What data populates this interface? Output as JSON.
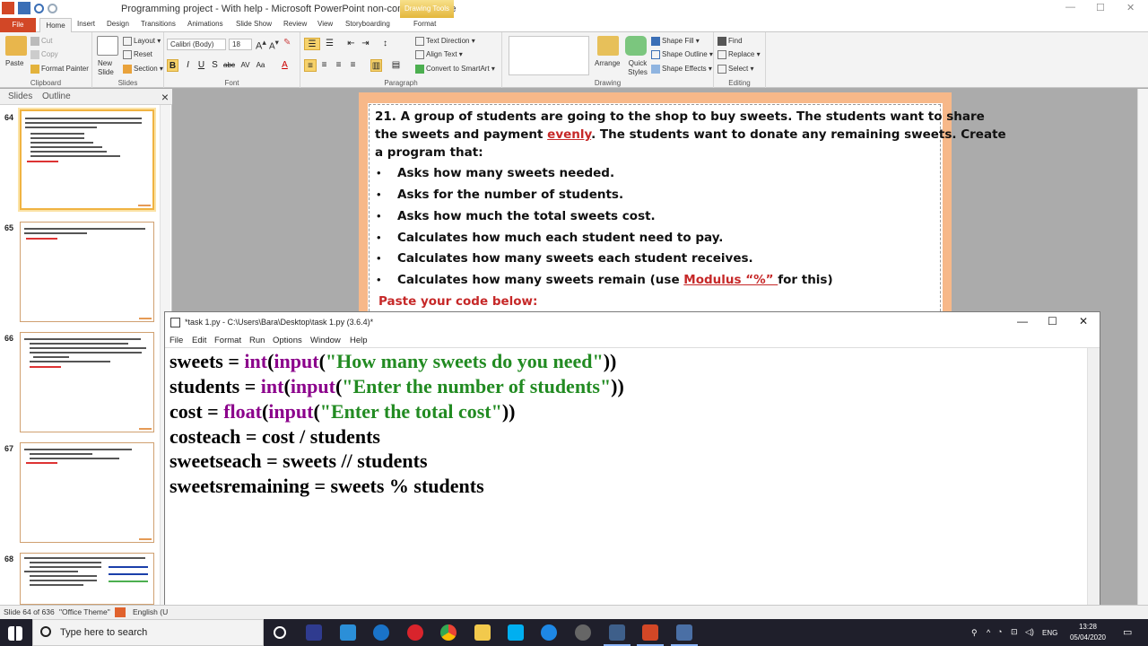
{
  "ppt": {
    "title": "Programming project - With help - Microsoft PowerPoint non-commercial use",
    "context_tab": "Drawing Tools",
    "tabs": [
      "File",
      "Home",
      "Insert",
      "Design",
      "Transitions",
      "Animations",
      "Slide Show",
      "Review",
      "View",
      "Storyboarding",
      "Format"
    ],
    "ribbon": {
      "clipboard": {
        "label": "Clipboard",
        "paste": "Paste",
        "cut": "Cut",
        "copy": "Copy",
        "format_painter": "Format Painter"
      },
      "slides": {
        "label": "Slides",
        "new_slide": "New Slide",
        "layout": "Layout",
        "reset": "Reset",
        "section": "Section"
      },
      "font": {
        "label": "Font",
        "font_name": "Calibri (Body)",
        "font_size": "18"
      },
      "paragraph": {
        "label": "Paragraph",
        "text_direction": "Text Direction",
        "align_text": "Align Text",
        "smartart": "Convert to SmartArt"
      },
      "drawing": {
        "label": "Drawing",
        "arrange": "Arrange",
        "quick_styles": "Quick Styles",
        "shape_fill": "Shape Fill",
        "shape_outline": "Shape Outline",
        "shape_effects": "Shape Effects"
      },
      "editing": {
        "label": "Editing",
        "find": "Find",
        "replace": "Replace",
        "select": "Select"
      }
    },
    "panel_tabs": {
      "slides": "Slides",
      "outline": "Outline"
    },
    "slide_numbers": [
      "64",
      "65",
      "66",
      "67",
      "68"
    ],
    "slide": {
      "heading_lines": [
        "21. A group of students are going to the shop to buy sweets. The students want to share",
        "the sweets and payment ",
        "evenly",
        ". The students want to donate any remaining sweets. Create",
        "a program that:"
      ],
      "bullets": [
        "Asks how many sweets needed.",
        "Asks for the number of students.",
        "Asks how much the total sweets cost.",
        "Calculates how much each student need to pay.",
        "Calculates how many sweets each student receives.",
        "Calculates how many sweets remain (use "
      ],
      "modulus_text": "Modulus “%” ",
      "modulus_suffix": "for this)",
      "paste_prompt": "Paste your code below:"
    },
    "status": {
      "slide_of": "Slide 64 of 636",
      "theme": "\"Office Theme\"",
      "language": "English (U"
    }
  },
  "idle": {
    "title": "*task 1.py - C:\\Users\\Bara\\Desktop\\task 1.py (3.6.4)*",
    "menus": [
      "File",
      "Edit",
      "Format",
      "Run",
      "Options",
      "Window",
      "Help"
    ],
    "code": {
      "l1": {
        "a": "sweets = ",
        "f1": "int",
        "p1": "(",
        "f2": "input",
        "p2": "(",
        "s": "\"How many sweets do you need\"",
        "e": "))"
      },
      "l2": {
        "a": "students = ",
        "f1": "int",
        "p1": "(",
        "f2": "input",
        "p2": "(",
        "s": "\"Enter the number of students\"",
        "e": "))"
      },
      "l3": {
        "a": "cost = ",
        "f1": "float",
        "p1": "(",
        "f2": "input",
        "p2": "(",
        "s": "\"Enter the total cost\"",
        "e": "))"
      },
      "l4": "costeach = cost / students",
      "l5": "sweetseach = sweets // students",
      "l6": "sweetsremaining = sweets % students"
    }
  },
  "taskbar": {
    "search_placeholder": "Type here to search",
    "lang": "ENG",
    "time": "13:28",
    "date": "05/04/2020"
  }
}
